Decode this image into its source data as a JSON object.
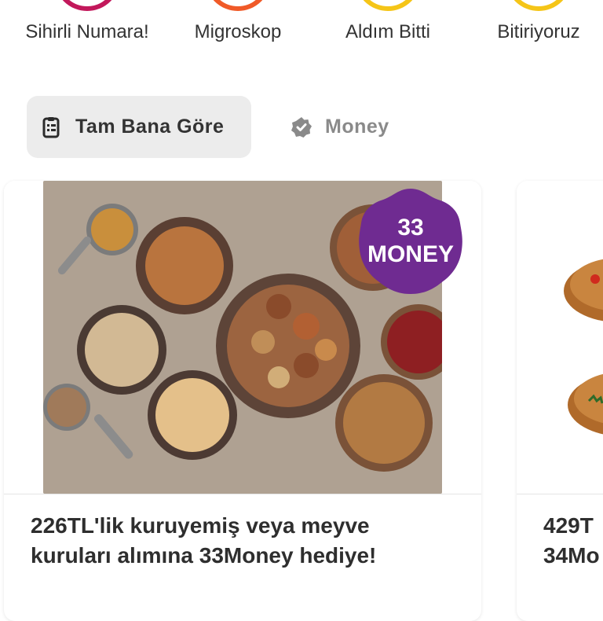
{
  "stories": [
    {
      "label": "Sihirli Numara!",
      "ring_color": "#c2185b"
    },
    {
      "label": "Migroskop",
      "ring_color": "#f05a28"
    },
    {
      "label": "Aldım Bitti",
      "ring_color": "#f5c518"
    },
    {
      "label": "Bitiriyoruz",
      "ring_color": "#f5c518"
    }
  ],
  "tabs": {
    "active": {
      "label": "Tam Bana Göre",
      "icon": "list-icon"
    },
    "inactive": {
      "label": "Money",
      "icon": "verified-badge-icon"
    }
  },
  "cards": [
    {
      "badge_line1": "33",
      "badge_line2": "MONEY",
      "badge_color": "#6f2b91",
      "title": "226TL'lik kuruyemiş veya meyve kuruları alımına 33Money hediye!"
    },
    {
      "title_line1": "429T",
      "title_line2": "34Mo"
    }
  ]
}
